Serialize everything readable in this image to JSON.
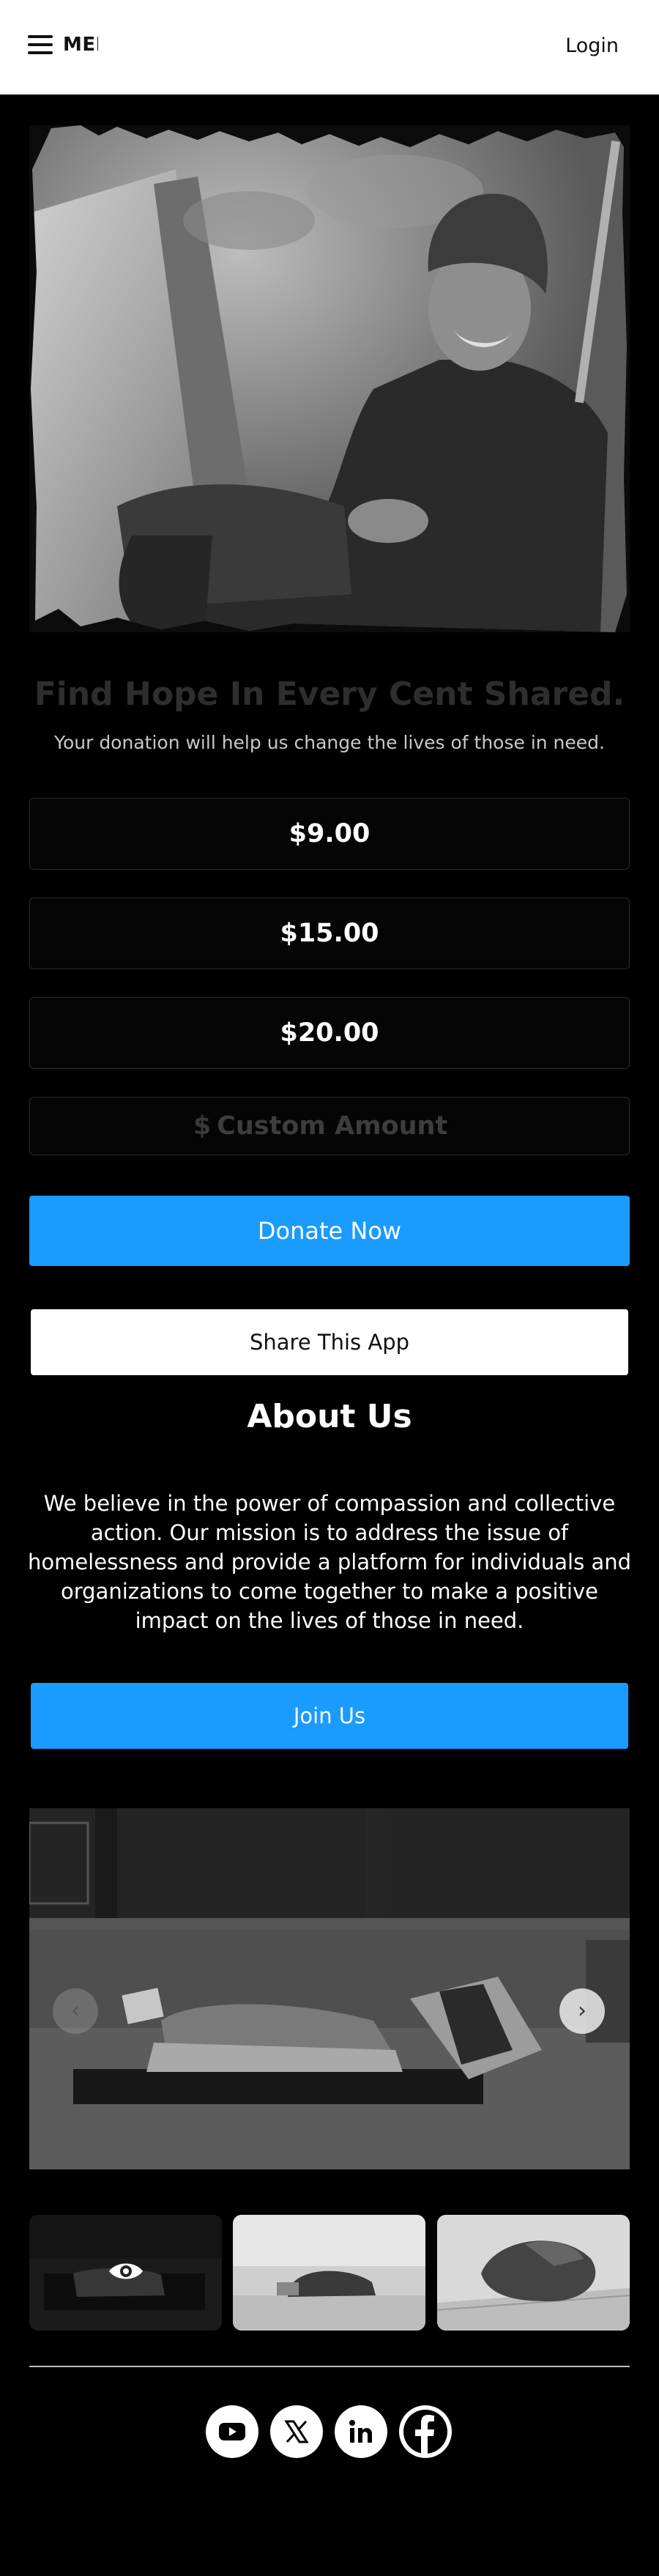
{
  "header": {
    "menu_label": "MENU",
    "login_label": "Login"
  },
  "hero": {
    "image_alt": "Elderly man in knit cap sitting on the street"
  },
  "headline": "Find Hope In Every Cent Shared.",
  "subline": "Your donation will help us change the lives of those in need.",
  "amounts": [
    "$9.00",
    "$15.00",
    "$20.00"
  ],
  "custom": {
    "currency": "$",
    "placeholder": "Custom Amount",
    "value": ""
  },
  "buttons": {
    "donate": "Donate Now",
    "share": "Share This App",
    "join": "Join Us"
  },
  "about": {
    "title": "About Us",
    "text": "We believe in the power of compassion and collective action. Our mission is to address the issue of homelessness and provide a platform for individuals and organizations to come together to make a positive impact on the lives of those in need."
  },
  "carousel": {
    "prev_icon": "chevron-left-icon",
    "next_icon": "chevron-right-icon"
  },
  "social": [
    "youtube-icon",
    "x-icon",
    "linkedin-icon",
    "facebook-icon"
  ]
}
